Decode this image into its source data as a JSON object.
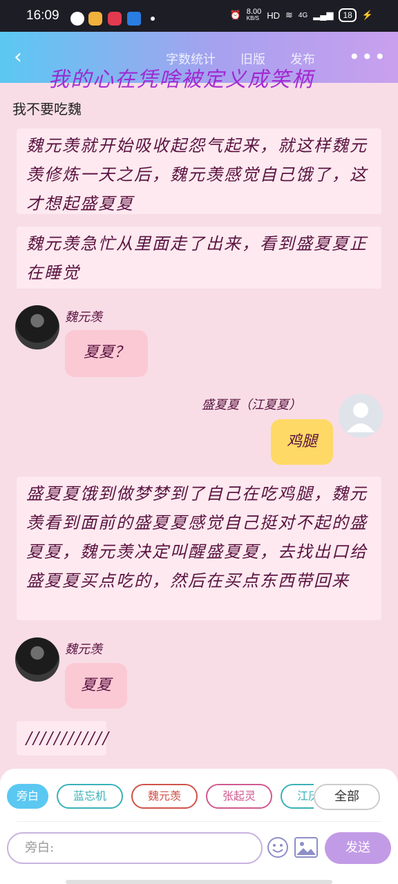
{
  "status_bar": {
    "time": "16:09",
    "speed": "8.00",
    "speed_unit": "KB/S",
    "network": "HD",
    "signal": "4G",
    "battery": "18"
  },
  "header": {
    "menu": [
      "字数统计",
      "旧版",
      "发布"
    ],
    "title": "我的心在凭啥被定义成笑柄"
  },
  "work_title": "我不要吃魏",
  "messages": {
    "narr1": "魏元羡就开始吸收起怨气起来，就这样魏元羡修炼一天之后，魏元羡感觉自己饿了，这才想起盛夏夏",
    "narr2": "魏元羡急忙从里面走了出来，看到盛夏夏正在睡觉",
    "char1_name": "魏元羡",
    "char1_text": "夏夏？",
    "user_name": "盛夏夏（江夏夏）",
    "user_text": "鸡腿",
    "narr3": "盛夏夏饿到做梦梦到了自己在吃鸡腿，魏元羡看到面前的盛夏夏感觉自己挺对不起的盛夏夏，魏元羡决定叫醒盛夏夏，去找出口给盛夏夏买点吃的，然后在买点东西带回来",
    "char2_name": "魏元羡",
    "char2_text": "夏夏",
    "narr4": "////////////"
  },
  "bottom": {
    "chips": [
      "旁白",
      "蓝忘机",
      "魏元羡",
      "张起灵",
      "江厌离"
    ],
    "all_label": "全部",
    "input_placeholder": "旁白:",
    "send_label": "发送"
  },
  "colors": {
    "header_start": "#5bc8f2",
    "header_end": "#c9a0ee",
    "background": "#f8dde6",
    "char_bubble": "#fbc9d4",
    "user_bubble": "#ffd966",
    "accent": "#c29be6"
  }
}
